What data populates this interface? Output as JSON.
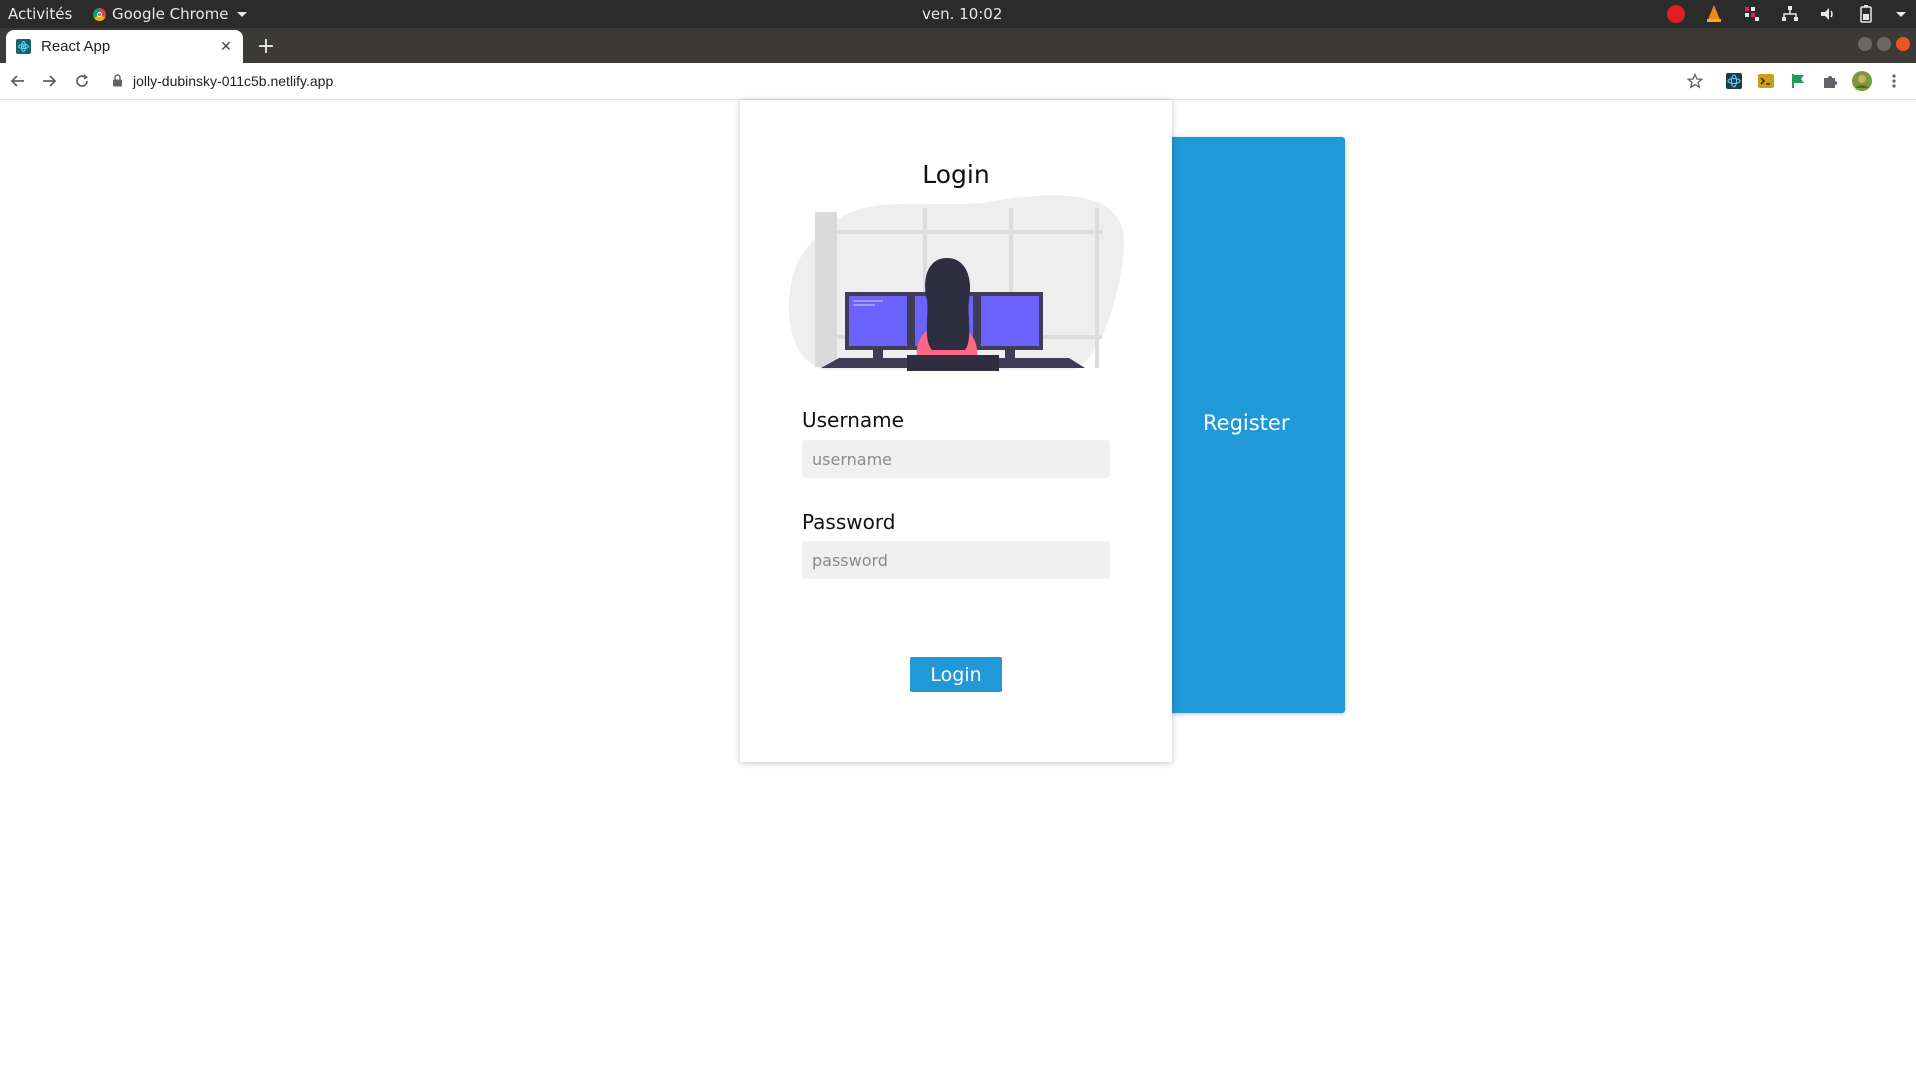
{
  "system_bar": {
    "activities": "Activités",
    "app_name": "Google Chrome",
    "clock": "ven. 10:02"
  },
  "browser": {
    "tab_title": "React App",
    "url": "jolly-dubinsky-011c5b.netlify.app"
  },
  "login": {
    "title": "Login",
    "username_label": "Username",
    "username_placeholder": "username",
    "password_label": "Password",
    "password_placeholder": "password",
    "submit_label": "Login"
  },
  "register": {
    "label": "Register"
  },
  "colors": {
    "accent": "#2199d8",
    "illustration_monitor": "#6c63ff",
    "illustration_shirt": "#ff6584",
    "illustration_dark": "#3f3d56"
  }
}
